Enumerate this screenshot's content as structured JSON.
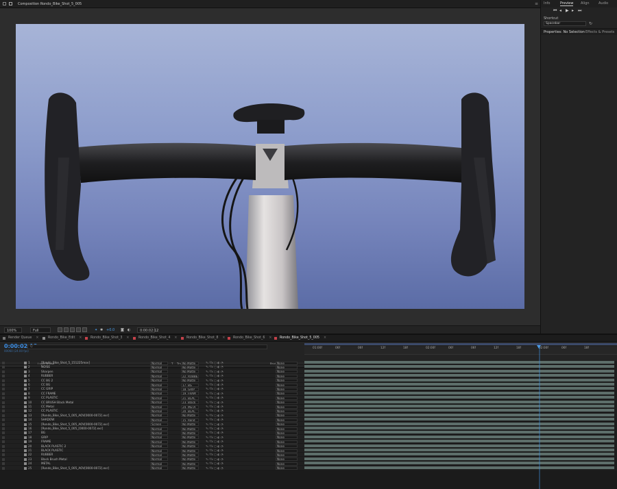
{
  "composition": {
    "tab_label": "Composition Rondo_Bike_Shot_5_005",
    "zoom": "100%",
    "resolution": "Full",
    "timecode": "0:00:02:12",
    "channel": "+0.0"
  },
  "right_panel": {
    "tabs": [
      "Info",
      "Preview",
      "Align",
      "Audio"
    ],
    "shortcut_label": "Shortcut",
    "shortcut_value": "Spacebar",
    "properties_tab": "Properties: No Selection",
    "effects_tab": "Effects & Presets"
  },
  "timeline": {
    "tabs": [
      {
        "label": "Render Queue",
        "color": "#777777"
      },
      {
        "label": "Rondo_Bike_Edit",
        "color": "#8a8a8a"
      },
      {
        "label": "Rondo_Bike_Shot_3",
        "color": "#c4414a"
      },
      {
        "label": "Rondo_Bike_Shot_4",
        "color": "#c4414a"
      },
      {
        "label": "Rondo_Bike_Shot_8",
        "color": "#c4414a"
      },
      {
        "label": "Rondo_Bike_Shot_6",
        "color": "#c4414a"
      },
      {
        "label": "Rondo_Bike_Shot_5_005",
        "color": "#c4414a"
      }
    ],
    "timecode": "0:00:02:12",
    "timecode_sub": "00060 (24.00 fps)",
    "search_placeholder": "Q",
    "columns": {
      "layer_name": "Layer Name",
      "mode": "Mode",
      "t": "T",
      "track_matte": "Track Matte",
      "parent": "Parent & Link"
    },
    "ruler_ticks": [
      "01:00f",
      "06f",
      "06f",
      "12f",
      "18f",
      "02:00f",
      "06f",
      "06f",
      "12f",
      "18f",
      "02:00f",
      "06f",
      "18f"
    ],
    "layers": [
      {
        "num": "1",
        "name": "[Rondo_Bike_Shot_5_151225mov]",
        "mode": "Normal",
        "matte": "No Matte",
        "parent": "None",
        "label": "#8a8a8a"
      },
      {
        "num": "2",
        "name": "NOISE",
        "mode": "Normal",
        "matte": "No Matte",
        "parent": "None",
        "label": "#8a8a8a"
      },
      {
        "num": "3",
        "name": "Sharpen",
        "mode": "Normal",
        "matte": "No Matte",
        "parent": "None",
        "label": "#8a8a8a"
      },
      {
        "num": "4",
        "name": "RUBBER",
        "mode": "Normal",
        "matte": "22. RUBBE",
        "parent": "None",
        "label": "#8a8a8a"
      },
      {
        "num": "5",
        "name": "CC BG 2",
        "mode": "Normal",
        "matte": "No Matte",
        "parent": "None",
        "label": "#8a8a8a"
      },
      {
        "num": "6",
        "name": "CC BG",
        "mode": "Normal",
        "matte": "17. BG",
        "parent": "None",
        "label": "#8a8a8a"
      },
      {
        "num": "7",
        "name": "CC GRIP",
        "mode": "Normal",
        "matte": "18. GRIP",
        "parent": "None",
        "label": "#8a8a8a"
      },
      {
        "num": "8",
        "name": "CC FRAME",
        "mode": "Normal",
        "matte": "19. FRAM",
        "parent": "None",
        "label": "#8a8a8a"
      },
      {
        "num": "9",
        "name": "CC PLASTIC",
        "mode": "Normal",
        "matte": "21. BLAC",
        "parent": "None",
        "label": "#8a8a8a"
      },
      {
        "num": "10",
        "name": "CC BRUSH Black Metal",
        "mode": "Normal",
        "matte": "23. Black",
        "parent": "None",
        "label": "#8a8a8a"
      },
      {
        "num": "11",
        "name": "CC Metal",
        "mode": "Normal",
        "matte": "24. META",
        "parent": "None",
        "label": "#8a8a8a"
      },
      {
        "num": "12",
        "name": "CC PLASTIC",
        "mode": "Normal",
        "matte": "20. BLAC",
        "parent": "None",
        "label": "#8a8a8a"
      },
      {
        "num": "13",
        "name": "[Rondo_Bike_Shot_5_005_AOV[0000-0072].exr]",
        "mode": "Normal",
        "matte": "No Matte",
        "parent": "None",
        "label": "#8a8a8a"
      },
      {
        "num": "14",
        "name": "SHADOW",
        "mode": "Normal",
        "matte": "15. Rond",
        "parent": "None",
        "label": "#8a8a8a"
      },
      {
        "num": "15",
        "name": "[Rondo_Bike_Shot_5_005_AOV[0000-0072].exr]",
        "mode": "Screen",
        "matte": "No Matte",
        "parent": "None",
        "label": "#8a8a8a"
      },
      {
        "num": "16",
        "name": "[Rondo_Bike_Shot_5_005_[0000-0072].exr]",
        "mode": "Normal",
        "matte": "No Matte",
        "parent": "None",
        "label": "#8a8a8a"
      },
      {
        "num": "17",
        "name": "BG",
        "mode": "Normal",
        "matte": "No Matte",
        "parent": "None",
        "label": "#8a8a8a"
      },
      {
        "num": "18",
        "name": "GRIP",
        "mode": "Normal",
        "matte": "No Matte",
        "parent": "None",
        "label": "#8a8a8a"
      },
      {
        "num": "19",
        "name": "FRAME",
        "mode": "Normal",
        "matte": "No Matte",
        "parent": "None",
        "label": "#8a8a8a"
      },
      {
        "num": "20",
        "name": "BLACK PLASTIC 2",
        "mode": "Normal",
        "matte": "No Matte",
        "parent": "None",
        "label": "#8a8a8a"
      },
      {
        "num": "21",
        "name": "BLACK PLASTIC",
        "mode": "Normal",
        "matte": "No Matte",
        "parent": "None",
        "label": "#8a8a8a"
      },
      {
        "num": "22",
        "name": "RUBBER",
        "mode": "Normal",
        "matte": "No Matte",
        "parent": "None",
        "label": "#8a8a8a"
      },
      {
        "num": "23",
        "name": "Black Brush Metal",
        "mode": "Normal",
        "matte": "No Matte",
        "parent": "None",
        "label": "#8a8a8a"
      },
      {
        "num": "24",
        "name": "METAL",
        "mode": "Normal",
        "matte": "No Matte",
        "parent": "None",
        "label": "#8a8a8a"
      },
      {
        "num": "25",
        "name": "[Rondo_Bike_Shot_5_005_AOV[0000-0072].exr]",
        "mode": "Normal",
        "matte": "No Matte",
        "parent": "None",
        "label": "#8a8a8a"
      }
    ]
  }
}
